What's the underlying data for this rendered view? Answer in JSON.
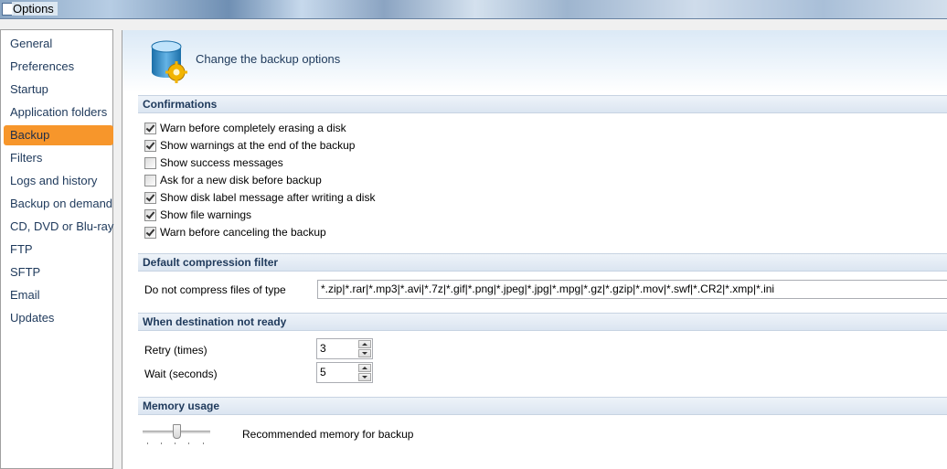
{
  "window": {
    "title": "Options"
  },
  "sidebar": {
    "items": [
      {
        "label": "General"
      },
      {
        "label": "Preferences"
      },
      {
        "label": "Startup"
      },
      {
        "label": "Application folders"
      },
      {
        "label": "Backup",
        "selected": true
      },
      {
        "label": "Filters"
      },
      {
        "label": "Logs and history"
      },
      {
        "label": "Backup on demand"
      },
      {
        "label": "CD, DVD or Blu-ray"
      },
      {
        "label": "FTP"
      },
      {
        "label": "SFTP"
      },
      {
        "label": "Email"
      },
      {
        "label": "Updates"
      }
    ]
  },
  "header": {
    "title": "Change the backup options",
    "icon": "database-settings-icon"
  },
  "sections": {
    "confirmations": {
      "title": "Confirmations",
      "options": [
        {
          "label": "Warn before completely erasing a disk",
          "checked": true
        },
        {
          "label": "Show warnings at the end of the backup",
          "checked": true
        },
        {
          "label": "Show success messages",
          "checked": false
        },
        {
          "label": "Ask for a new disk before backup",
          "checked": false
        },
        {
          "label": "Show disk label message after writing a disk",
          "checked": true
        },
        {
          "label": "Show file warnings",
          "checked": true
        },
        {
          "label": "Warn before canceling the backup",
          "checked": true
        }
      ]
    },
    "compression": {
      "title": "Default compression filter",
      "label": "Do not compress files of type",
      "value": "*.zip|*.rar|*.mp3|*.avi|*.7z|*.gif|*.png|*.jpeg|*.jpg|*.mpg|*.gz|*.gzip|*.mov|*.swf|*.CR2|*.xmp|*.ini"
    },
    "destination": {
      "title": "When destination not ready",
      "retry_label": "Retry (times)",
      "retry_value": "3",
      "wait_label": "Wait (seconds)",
      "wait_value": "5"
    },
    "memory": {
      "title": "Memory usage",
      "label": "Recommended memory for backup",
      "slider_level": 0.5
    }
  },
  "colors": {
    "selected_item": "#f7962b",
    "link_text": "#1e395b"
  }
}
